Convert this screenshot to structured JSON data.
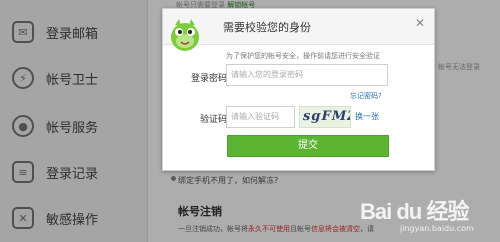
{
  "background": {
    "top_note_prefix": "帐号只需要登录",
    "top_note_link": "解锁帐号",
    "right_edge_text": "帐号无法登录",
    "bullet_text": "绑定手机不用了，如何解冻?",
    "section_title": "帐号注销",
    "desc_prefix": "一旦注销成功，帐号将",
    "desc_highlight": "永久不可使用",
    "desc_middle": "且帐号",
    "desc_highlight2": "信息将会被清空",
    "desc_suffix": "，请"
  },
  "sidebar": {
    "items": [
      {
        "label": "登录邮箱",
        "icon": "mail-icon"
      },
      {
        "label": "帐号卫士",
        "icon": "shield-icon"
      },
      {
        "label": "帐号服务",
        "icon": "lock-icon"
      },
      {
        "label": "登录记录",
        "icon": "document-icon"
      },
      {
        "label": "敏感操作",
        "icon": "close-square-icon"
      }
    ]
  },
  "dialog": {
    "title": "需要校验您的身份",
    "close_glyph": "✕",
    "hint": "为了保护您的帐号安全，操作前请您进行安全验证",
    "password_label": "登录密码",
    "password_placeholder": "请输入您的登录密码",
    "forgot_link": "忘记密码?",
    "captcha_label": "验证码",
    "captcha_placeholder": "请输入验证码",
    "captcha_image_text": "sgFMZ",
    "refresh_link": "换一张",
    "submit_label": "提交"
  },
  "watermark": {
    "brand": "Bai du 经验",
    "sub": "jingyan.baidu.com"
  },
  "colors": {
    "submit_green": "#5cb532",
    "link_blue": "#2a6fb5",
    "danger_red": "#d33333"
  }
}
